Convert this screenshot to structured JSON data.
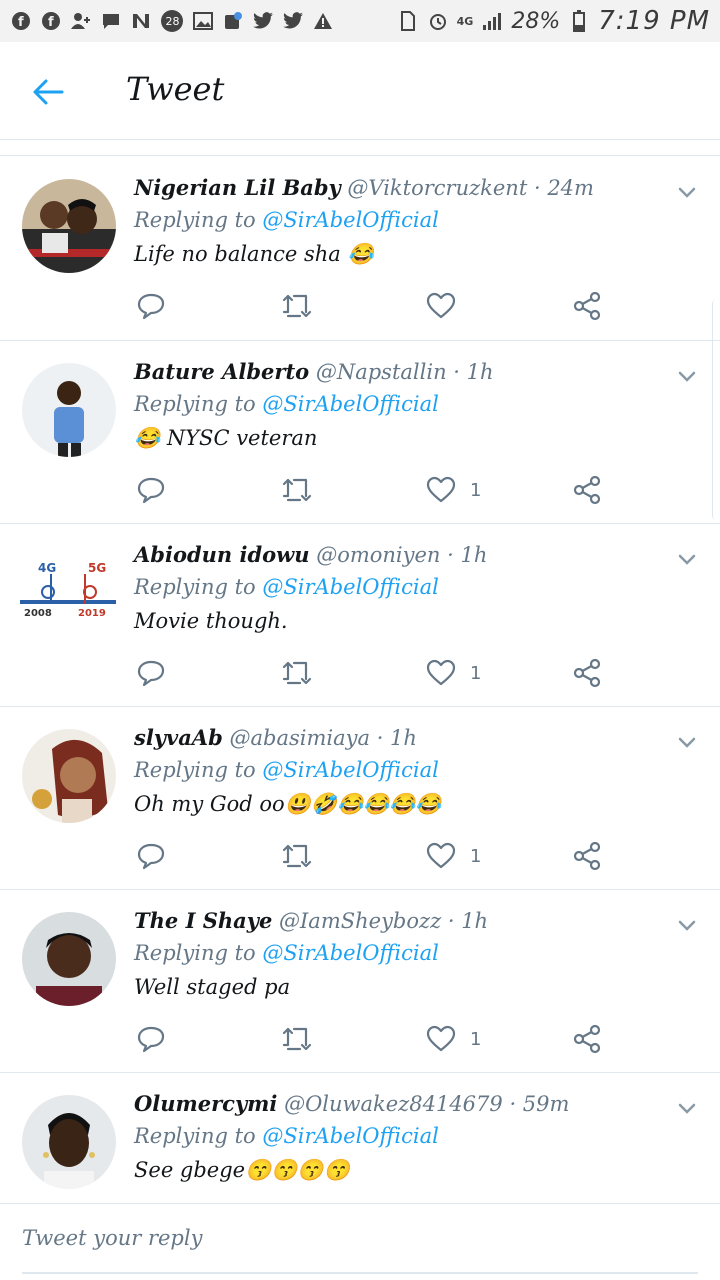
{
  "status_bar": {
    "notification_count": "28",
    "network": "4G",
    "battery": "28%",
    "time": "7:19 PM"
  },
  "header": {
    "title": "Tweet"
  },
  "tweets": [
    {
      "name": "Nigerian Lil Baby",
      "handle": "@Viktorcruzkent",
      "time": "· 24m",
      "replying_prefix": "Replying to ",
      "replying_to": "@SirAbelOfficial",
      "text": "Life no balance sha 😂",
      "likes": ""
    },
    {
      "name": "Bature Alberto",
      "handle": "@Napstallin",
      "time": "· 1h",
      "replying_prefix": "Replying to ",
      "replying_to": "@SirAbelOfficial",
      "text": "😂 NYSC veteran",
      "likes": "1"
    },
    {
      "name": "Abiodun idowu",
      "handle": "@omoniyen",
      "time": "· 1h",
      "replying_prefix": "Replying to ",
      "replying_to": "@SirAbelOfficial",
      "text": "Movie though.",
      "likes": "1",
      "avatar_text": {
        "a": "4G",
        "b": "5G",
        "c": "2008",
        "d": "2019"
      }
    },
    {
      "name": "slyvaAb",
      "handle": "@abasimiaya",
      "time": "· 1h",
      "replying_prefix": "Replying to ",
      "replying_to": "@SirAbelOfficial",
      "text": "Oh my God oo😃🤣😂😂😂😂",
      "likes": "1"
    },
    {
      "name": "The I Shaye",
      "handle": "@IamSheybozz",
      "time": "· 1h",
      "replying_prefix": "Replying to ",
      "replying_to": "@SirAbelOfficial",
      "text": "Well staged pa",
      "likes": "1"
    },
    {
      "name": "Olumercymi",
      "handle": "@Oluwakez8414679",
      "time": "· 59m",
      "replying_prefix": "Replying to ",
      "replying_to": "@SirAbelOfficial",
      "text": "See gbege😙😙😙😙",
      "likes": ""
    }
  ],
  "reply_box": {
    "placeholder": "Tweet your reply"
  },
  "colors": {
    "accent": "#1da1f2",
    "muted": "#657786",
    "divider": "#e1e8ed"
  }
}
